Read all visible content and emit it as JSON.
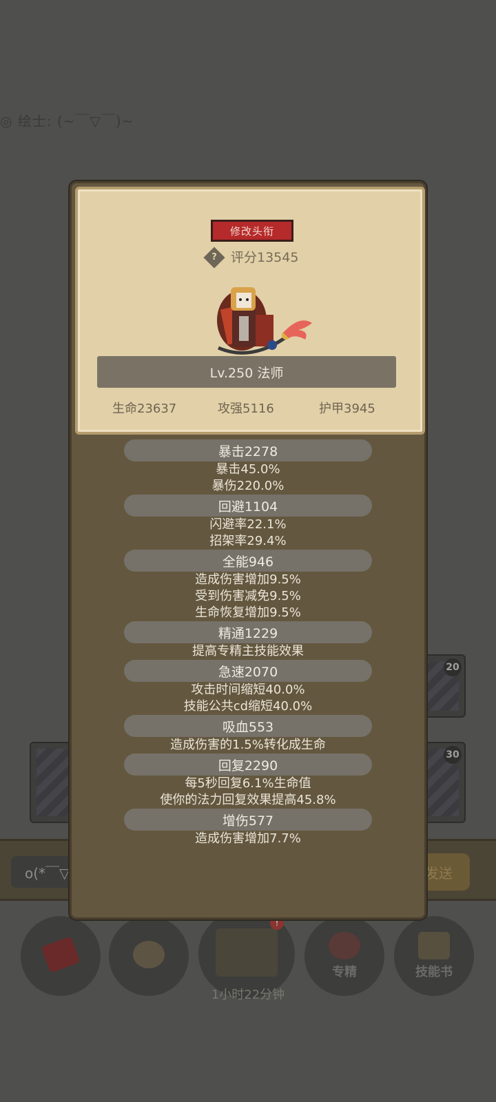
{
  "background": {
    "chat_line": "◎ 绘士: (~￣▽￣)~",
    "slots": [
      {
        "level": "20"
      },
      {
        "level": "30"
      }
    ],
    "chat_input": "o(*￣▽",
    "send_label": "发送",
    "nav": {
      "items": [
        {
          "label": ""
        },
        {
          "label": ""
        },
        {
          "label": ""
        },
        {
          "label": "专精"
        },
        {
          "label": "技能书"
        }
      ],
      "timer": "1小时22分钟",
      "badge": "!"
    }
  },
  "profile": {
    "edit_title_label": "修改头衔",
    "help_glyph": "?",
    "score": "评分13545",
    "name_level": "Lv.250 法师",
    "base_stats": [
      {
        "text": "生命23637"
      },
      {
        "text": "攻强5116"
      },
      {
        "text": "护甲3945"
      }
    ]
  },
  "sections": [
    {
      "head": "暴击2278",
      "lines": [
        "暴击45.0%",
        "暴伤220.0%"
      ]
    },
    {
      "head": "回避1104",
      "lines": [
        "闪避率22.1%",
        "招架率29.4%"
      ]
    },
    {
      "head": "全能946",
      "lines": [
        "造成伤害增加9.5%",
        "受到伤害减免9.5%",
        "生命恢复增加9.5%"
      ]
    },
    {
      "head": "精通1229",
      "lines": [
        "提高专精主技能效果"
      ]
    },
    {
      "head": "急速2070",
      "lines": [
        "攻击时间缩短40.0%",
        "技能公共cd缩短40.0%"
      ]
    },
    {
      "head": "吸血553",
      "lines": [
        "造成伤害的1.5%转化成生命"
      ]
    },
    {
      "head": "回复2290",
      "lines": [
        "每5秒回复6.1%生命值",
        "使你的法力回复效果提高45.8%"
      ]
    },
    {
      "head": "增伤577",
      "lines": [
        "造成伤害增加7.7%"
      ]
    }
  ]
}
